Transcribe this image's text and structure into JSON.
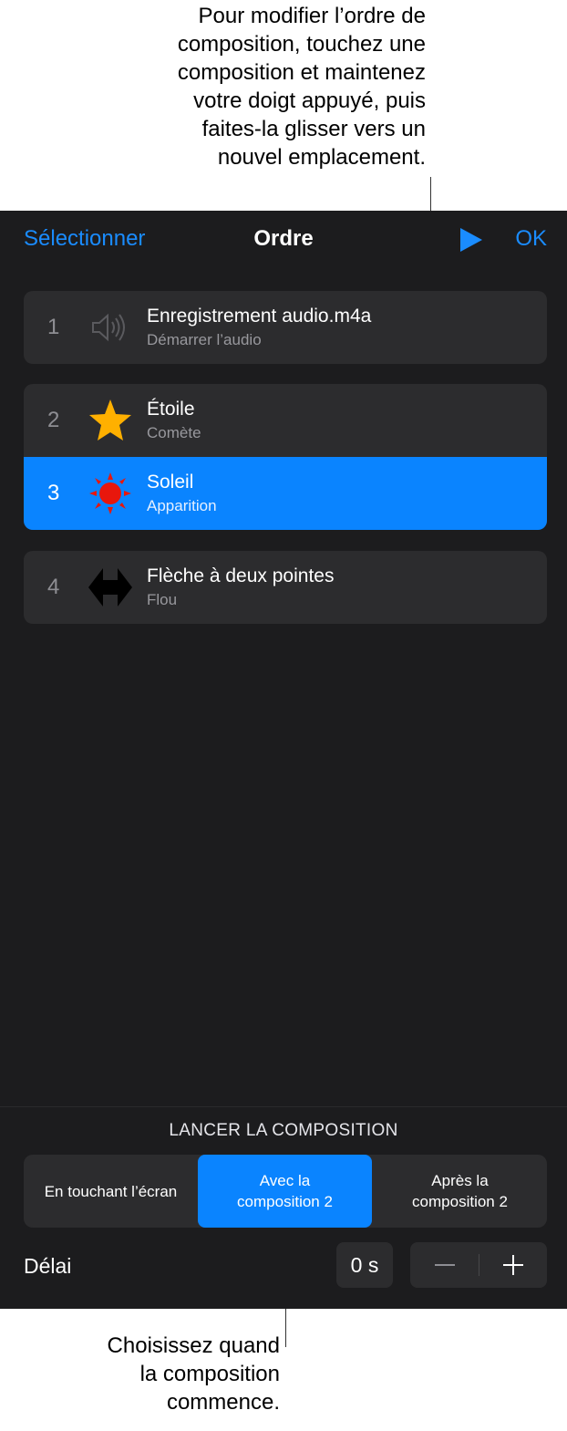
{
  "callouts": {
    "top": "Pour modifier l’ordre de\ncomposition, touchez une\ncomposition et maintenez\nvotre doigt appuyé, puis\nfaites-la glisser vers un\nnouvel emplacement.",
    "bottom": "Choisissez quand\nla composition\ncommence."
  },
  "nav": {
    "select": "Sélectionner",
    "title": "Ordre",
    "ok": "OK",
    "play_icon": "play-icon"
  },
  "builds": [
    {
      "number": "1",
      "title": "Enregistrement audio.m4a",
      "subtitle": "Démarrer l’audio",
      "icon": "speaker-icon"
    },
    {
      "number": "2",
      "title": "Étoile",
      "subtitle": "Comète",
      "icon": "star-icon"
    },
    {
      "number": "3",
      "title": "Soleil",
      "subtitle": "Apparition",
      "icon": "sun-icon",
      "selected": true
    },
    {
      "number": "4",
      "title": "Flèche à deux pointes",
      "subtitle": "Flou",
      "icon": "double-arrow-icon"
    }
  ],
  "start": {
    "label": "LANCER LA COMPOSITION",
    "options": [
      "En touchant l’écran",
      "Avec la\ncomposition 2",
      "Après la\ncomposition 2"
    ],
    "selected_index": 1
  },
  "delay": {
    "label": "Délai",
    "value": "0 s",
    "minus_icon": "minus-icon",
    "plus_icon": "plus-icon"
  },
  "colors": {
    "accent": "#0a84ff",
    "link": "#1a8cff",
    "panel": "#1c1c1e",
    "card": "#2c2c2e",
    "star": "#ffb000",
    "sun": "#e8170c"
  }
}
